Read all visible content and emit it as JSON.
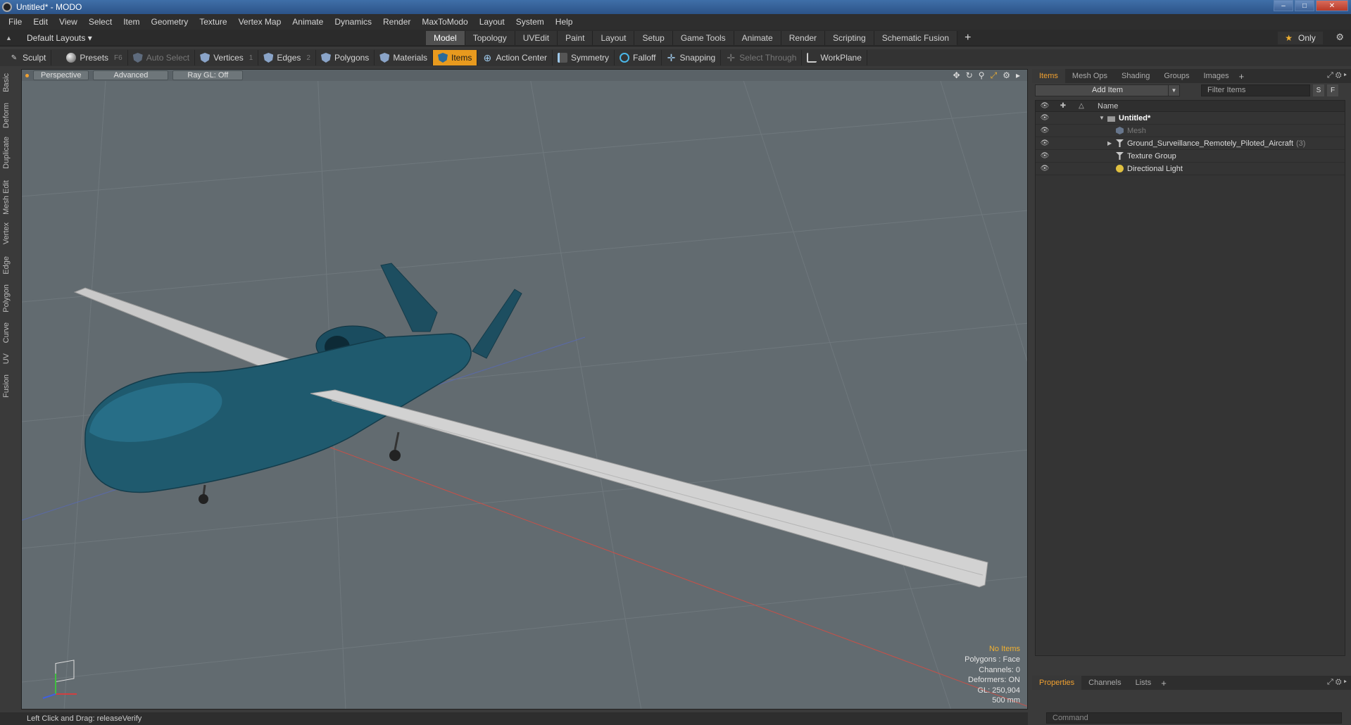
{
  "window": {
    "title": "Untitled* - MODO"
  },
  "menu": [
    "File",
    "Edit",
    "View",
    "Select",
    "Item",
    "Geometry",
    "Texture",
    "Vertex Map",
    "Animate",
    "Dynamics",
    "Render",
    "MaxToModo",
    "Layout",
    "System",
    "Help"
  ],
  "layouts": {
    "default_label": "Default Layouts ▾",
    "tabs": [
      "Model",
      "Topology",
      "UVEdit",
      "Paint",
      "Layout",
      "Setup",
      "Game Tools",
      "Animate",
      "Render",
      "Scripting",
      "Schematic Fusion"
    ],
    "active_tab": "Model",
    "add": "+",
    "only_label": "Only"
  },
  "toolbar": {
    "sculpt": "Sculpt",
    "presets": "Presets",
    "presets_key": "F6",
    "auto_select": "Auto Select",
    "vertices": "Vertices",
    "vertices_key": "1",
    "edges": "Edges",
    "edges_key": "2",
    "polygons": "Polygons",
    "materials": "Materials",
    "items": "Items",
    "action_center": "Action Center",
    "symmetry": "Symmetry",
    "falloff": "Falloff",
    "snapping": "Snapping",
    "select_through": "Select Through",
    "workplane": "WorkPlane"
  },
  "left_tabs": [
    "Basic",
    "Deform",
    "Duplicate",
    "Mesh Edit",
    "Vertex",
    "Edge",
    "Polygon",
    "Curve",
    "UV",
    "Fusion"
  ],
  "viewport": {
    "perspective": "Perspective",
    "advanced": "Advanced",
    "raygl": "Ray GL: Off",
    "info": {
      "no_items": "No Items",
      "polygons": "Polygons : Face",
      "channels": "Channels: 0",
      "deformers": "Deformers: ON",
      "gl": "GL: 250,904",
      "scale": "500 mm"
    }
  },
  "items_panel": {
    "tabs": [
      "Items",
      "Mesh Ops",
      "Shading",
      "Groups",
      "Images"
    ],
    "active_tab": "Items",
    "add_item": "Add Item",
    "filter_placeholder": "Filter Items",
    "s_btn": "S",
    "f_btn": "F",
    "name_header": "Name",
    "rows": [
      {
        "label": "Untitled*"
      },
      {
        "label": "Mesh"
      },
      {
        "label": "Ground_Surveillance_Remotely_Piloted_Aircraft",
        "count": "(3)"
      },
      {
        "label": "Texture Group"
      },
      {
        "label": "Directional Light"
      }
    ]
  },
  "properties_panel": {
    "tabs": [
      "Properties",
      "Channels",
      "Lists"
    ],
    "active_tab": "Properties",
    "command_placeholder": "Command"
  },
  "status": {
    "text": "Left Click and Drag:  releaseVerify"
  },
  "colors": {
    "accent": "#e89a1e",
    "viewport_bg": "#626b70",
    "aircraft": "#1f5a6e"
  }
}
